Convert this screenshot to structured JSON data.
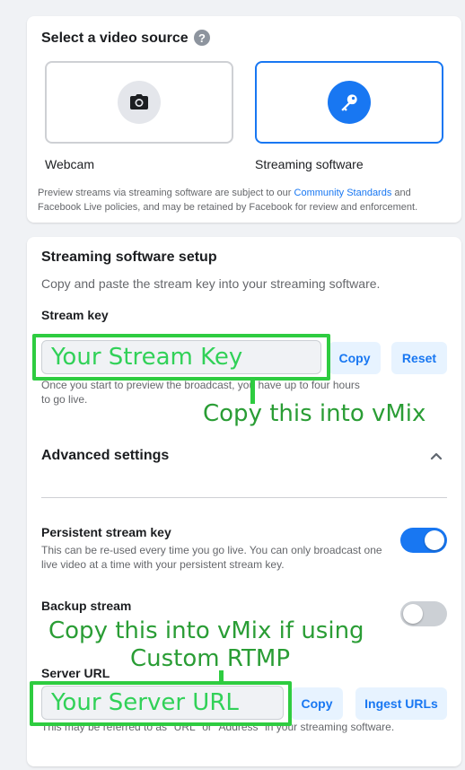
{
  "source_card": {
    "title": "Select a video source",
    "help_glyph": "?",
    "options": [
      {
        "label": "Webcam",
        "icon": "camera-icon"
      },
      {
        "label": "Streaming software",
        "icon": "key-icon",
        "selected": true
      }
    ],
    "policy_before": "Preview streams via streaming software are subject to our ",
    "policy_link": "Community Standards",
    "policy_after": " and Facebook Live policies, and may be retained by Facebook for review and enforcement."
  },
  "setup_card": {
    "title": "Streaming software setup",
    "subtitle": "Copy and paste the stream key into your streaming software.",
    "stream_key": {
      "label": "Stream key",
      "value": "Your Stream Key",
      "copy_label": "Copy",
      "reset_label": "Reset",
      "hint": "Once you start to preview the broadcast, you have up to four hours to go live."
    },
    "advanced": {
      "title": "Advanced settings",
      "persistent": {
        "label": "Persistent stream key",
        "description": "This can be re-used every time you go live. You can only broadcast one live video at a time with your persistent stream key.",
        "enabled": true
      },
      "backup": {
        "label": "Backup stream",
        "enabled": false
      }
    },
    "server_url": {
      "label": "Server URL",
      "value": "Your Server URL",
      "copy_label": "Copy",
      "ingest_label": "Ingest URLs",
      "hint": "This may be referred to as \"URL\" or \"Address\" in your streaming software."
    }
  },
  "annotations": {
    "stream_key_note": "Copy this into vMix",
    "server_note_line1": "Copy this into vMix if using",
    "server_note_line2": "Custom RTMP"
  },
  "colors": {
    "accent": "#1877f2",
    "annotation_green": "#2ecc40"
  }
}
